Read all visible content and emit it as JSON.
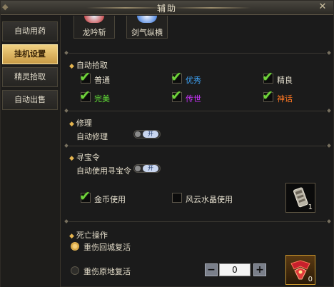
{
  "window": {
    "title": "辅助"
  },
  "sidebar": {
    "tabs": [
      {
        "label": "自动用药"
      },
      {
        "label": "挂机设置"
      },
      {
        "label": "精灵拾取"
      },
      {
        "label": "自动出售"
      }
    ]
  },
  "skills": [
    {
      "label": "龙吟斩"
    },
    {
      "label": "剑气纵横"
    }
  ],
  "pickup": {
    "title": "自动拾取",
    "options": [
      {
        "label": "普通",
        "color": "#e6e0cf",
        "checked": true
      },
      {
        "label": "优秀",
        "color": "#3fa8ff",
        "checked": true
      },
      {
        "label": "精良",
        "color": "#e6e0cf",
        "checked": true
      },
      {
        "label": "完美",
        "color": "#62e036",
        "checked": true
      },
      {
        "label": "传世",
        "color": "#cc33ff",
        "checked": true
      },
      {
        "label": "神话",
        "color": "#ff7722",
        "checked": true
      }
    ]
  },
  "repair": {
    "title": "修理",
    "auto_label": "自动修理",
    "toggle_text": "开"
  },
  "treasure": {
    "title": "寻宝令",
    "auto_label": "自动使用寻宝令",
    "toggle_text": "开",
    "gold_label": "金币使用",
    "crystal_label": "风云水晶使用",
    "item_count": "1"
  },
  "death": {
    "title": "死亡操作",
    "revive_city": "重伤回城复活",
    "revive_spot": "重伤原地复活",
    "stepper_value": "0",
    "stepper_minus": "−",
    "stepper_plus": "+",
    "item_count": "0"
  },
  "icons": {
    "close": "close-icon",
    "check": "checkmark-icon",
    "section_marker": "diamond-icon"
  }
}
